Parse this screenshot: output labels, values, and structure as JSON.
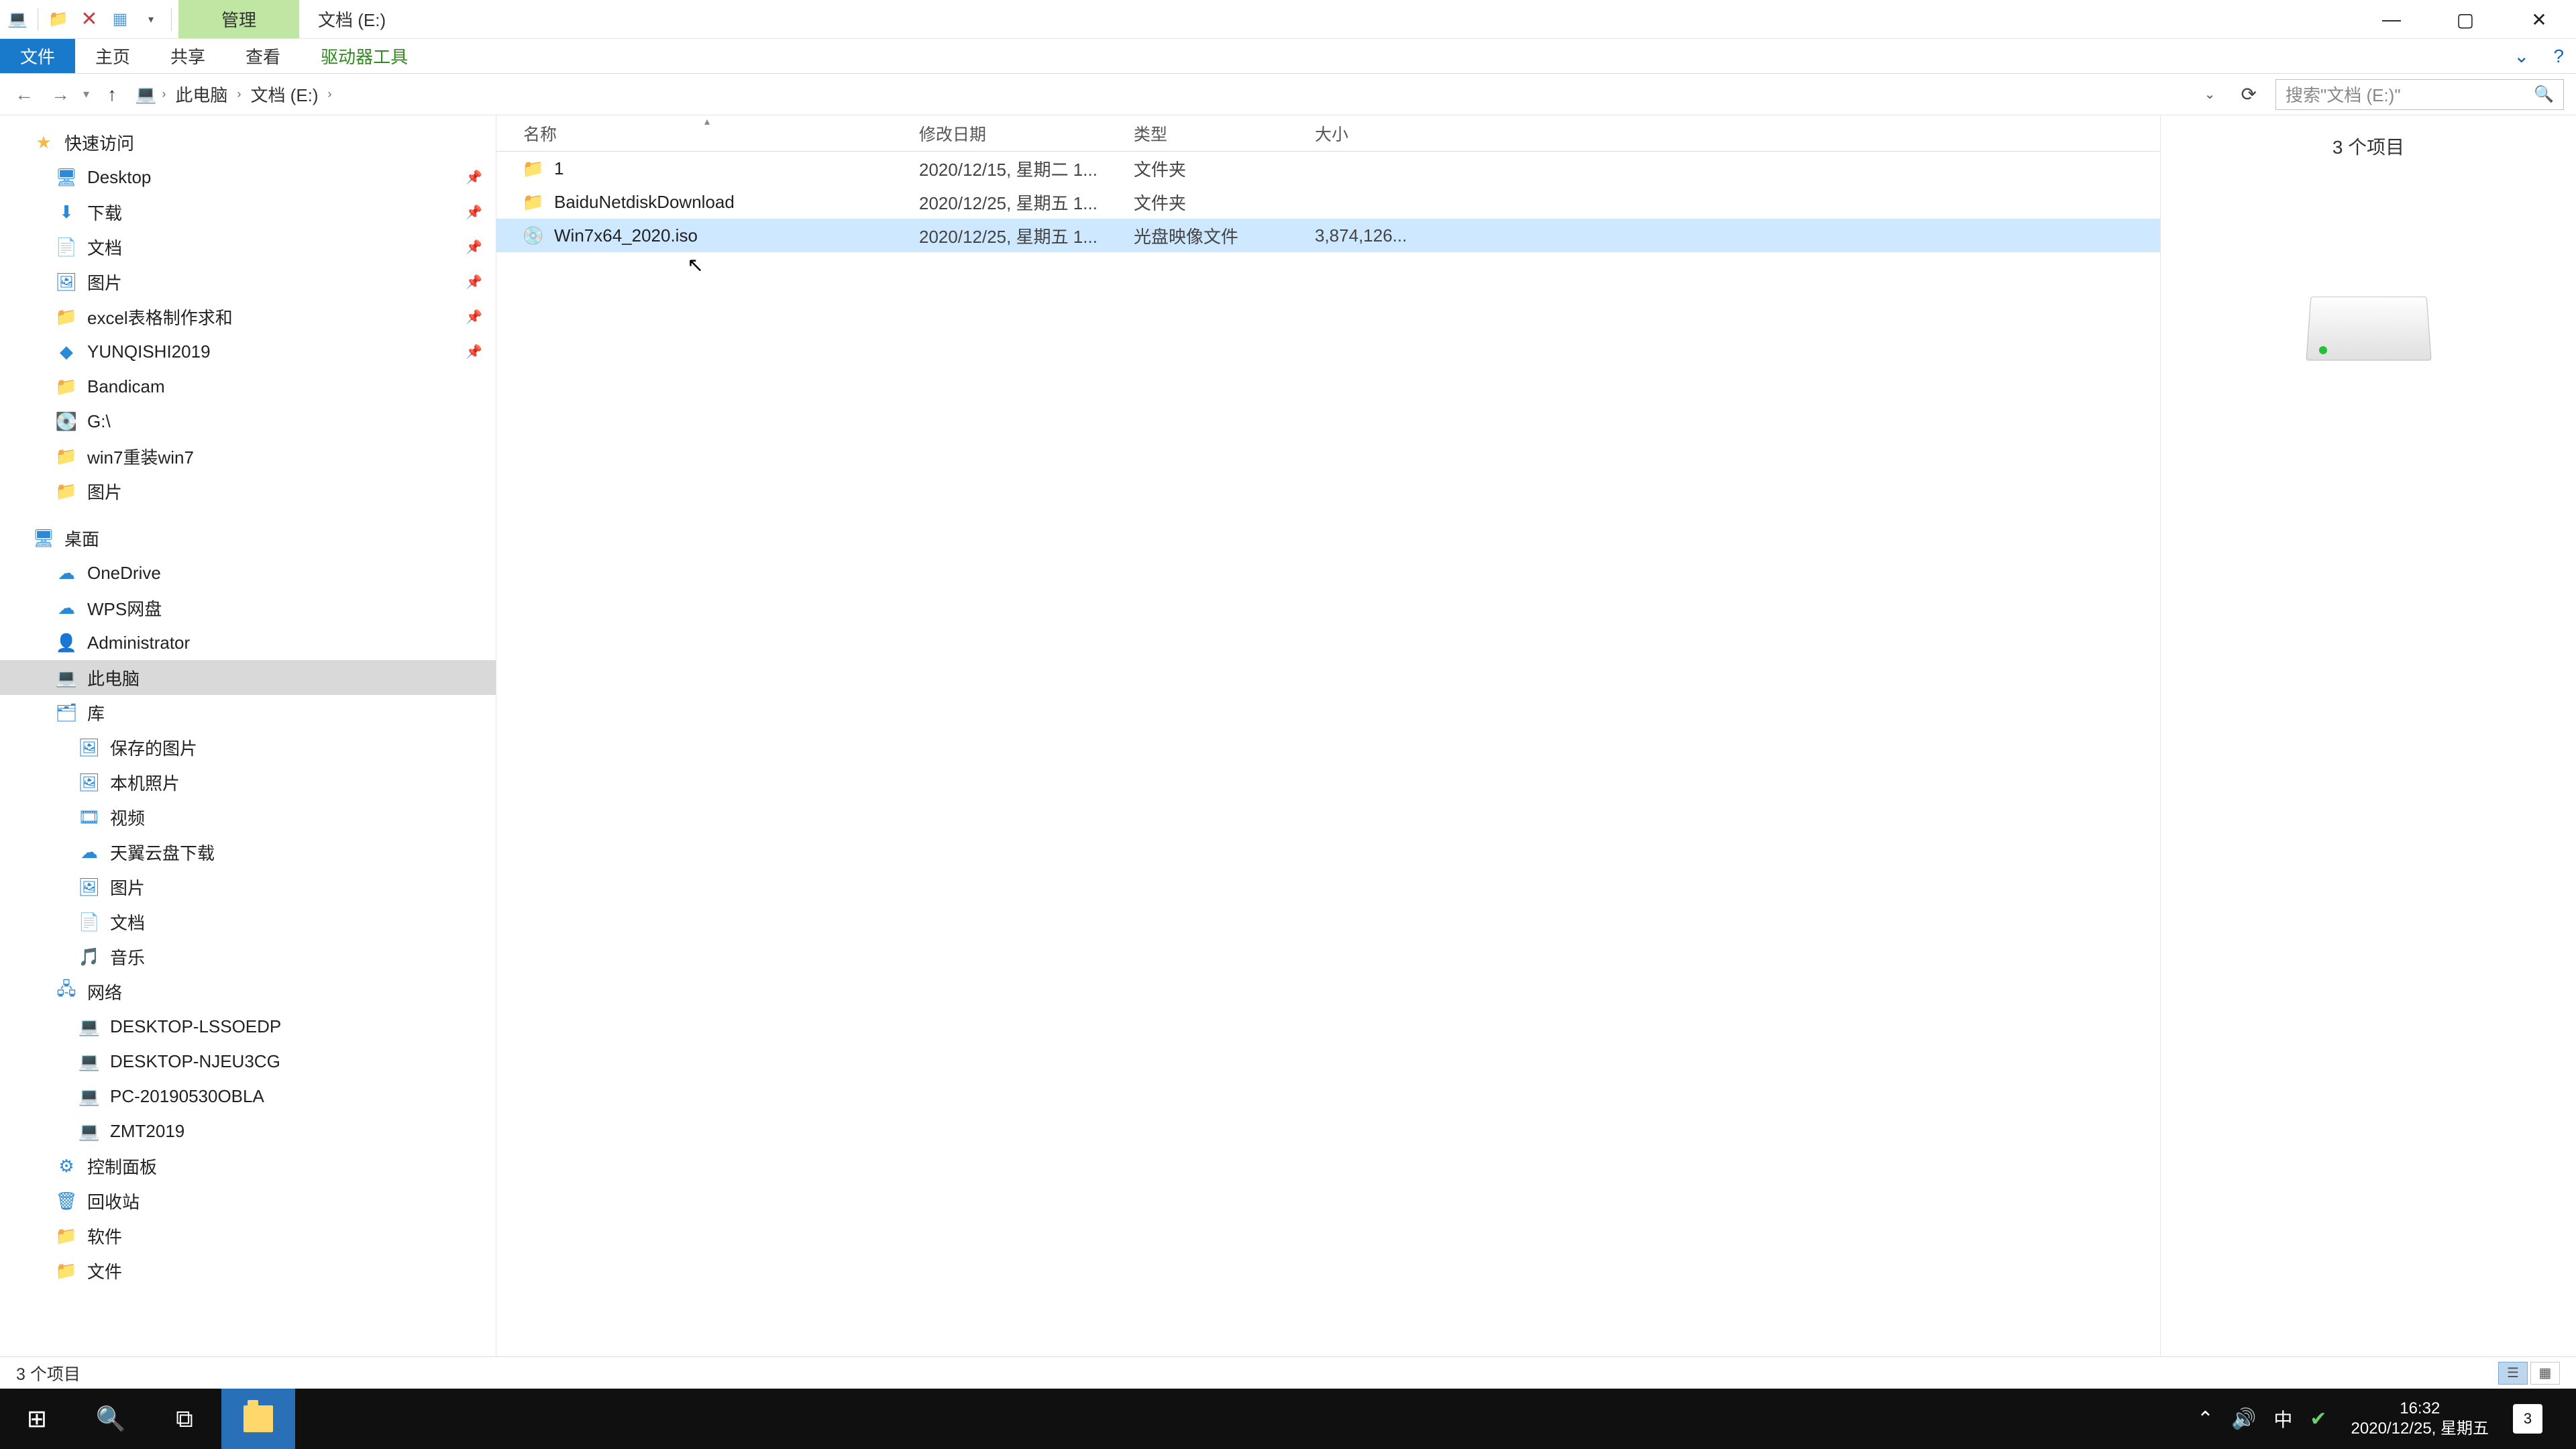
{
  "titlebar": {
    "context_tab": "管理",
    "window_title": "文档 (E:)"
  },
  "ribbon": {
    "file": "文件",
    "home": "主页",
    "share": "共享",
    "view": "查看",
    "drive_tools": "驱动器工具"
  },
  "breadcrumb": {
    "this_pc": "此电脑",
    "drive": "文档 (E:)"
  },
  "search": {
    "placeholder": "搜索\"文档 (E:)\""
  },
  "tree": {
    "quick_access": "快速访问",
    "desktop": "Desktop",
    "downloads": "下载",
    "documents": "文档",
    "pictures": "图片",
    "excel": "excel表格制作求和",
    "yunqishi": "YUNQISHI2019",
    "bandicam": "Bandicam",
    "gdrive": "G:\\",
    "win7": "win7重装win7",
    "pictures2": "图片",
    "section_desktop": "桌面",
    "onedrive": "OneDrive",
    "wps": "WPS网盘",
    "admin": "Administrator",
    "this_pc": "此电脑",
    "libraries": "库",
    "saved_pics": "保存的图片",
    "camera_roll": "本机照片",
    "videos": "视频",
    "tianyi": "天翼云盘下载",
    "pictures3": "图片",
    "docs": "文档",
    "music": "音乐",
    "network": "网络",
    "pc1": "DESKTOP-LSSOEDP",
    "pc2": "DESKTOP-NJEU3CG",
    "pc3": "PC-20190530OBLA",
    "pc4": "ZMT2019",
    "control_panel": "控制面板",
    "recycle": "回收站",
    "software": "软件",
    "files": "文件"
  },
  "columns": {
    "name": "名称",
    "date": "修改日期",
    "type": "类型",
    "size": "大小"
  },
  "rows": [
    {
      "name": "1",
      "date": "2020/12/15, 星期二 1...",
      "type": "文件夹",
      "size": "",
      "icon": "folder",
      "selected": false
    },
    {
      "name": "BaiduNetdiskDownload",
      "date": "2020/12/25, 星期五 1...",
      "type": "文件夹",
      "size": "",
      "icon": "folder",
      "selected": false
    },
    {
      "name": "Win7x64_2020.iso",
      "date": "2020/12/25, 星期五 1...",
      "type": "光盘映像文件",
      "size": "3,874,126...",
      "icon": "iso",
      "selected": true
    }
  ],
  "preview": {
    "item_count": "3 个项目"
  },
  "status": {
    "text": "3 个项目"
  },
  "taskbar": {
    "ime": "中",
    "time": "16:32",
    "date": "2020/12/25, 星期五",
    "badge": "3"
  }
}
